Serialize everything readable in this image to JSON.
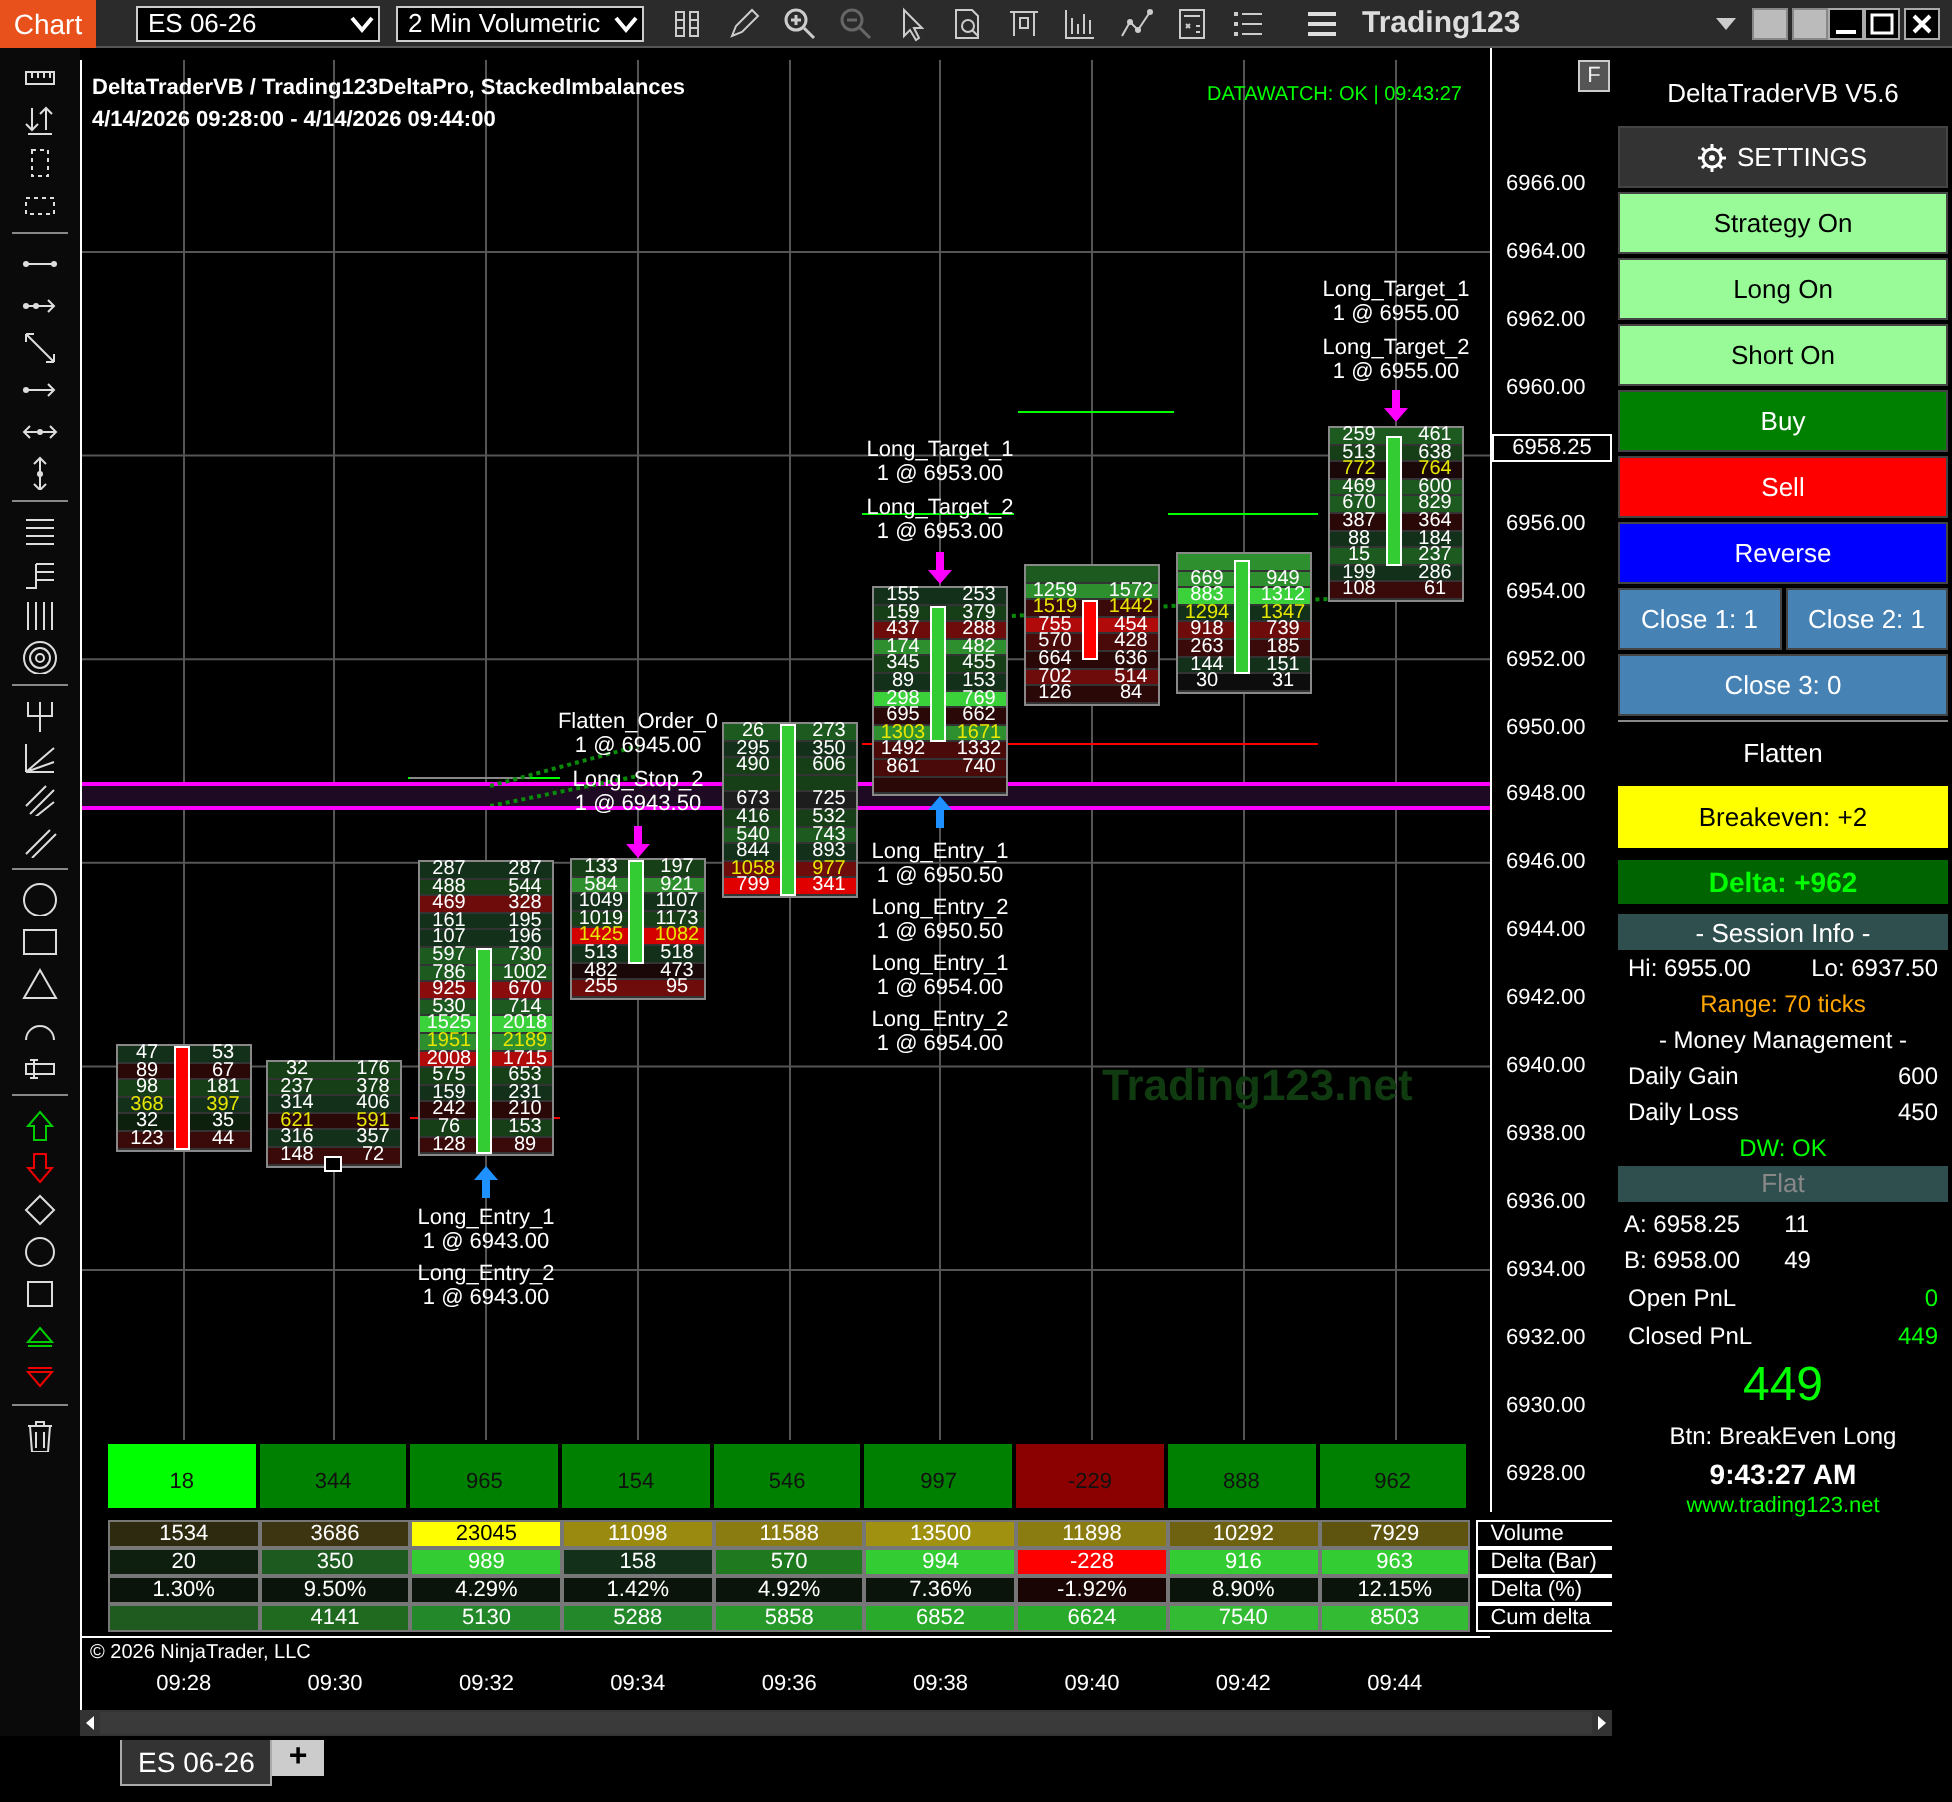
{
  "topbar": {
    "tab": "Chart",
    "instrument": "ES 06-26",
    "interval": "2 Min Volumetric",
    "workspace": "Trading123"
  },
  "chart": {
    "title": "DeltaTraderVB / Trading123DeltaPro, StackedImbalances",
    "range": "4/14/2026 09:28:00 - 4/14/2026 09:44:00",
    "datawatch": "DATAWATCH: OK | 09:43:27",
    "f_button": "F",
    "watermark": "Trading123.net",
    "copyright": "© 2026 NinjaTrader, LLC",
    "price_labels": [
      "6966.00",
      "6964.00",
      "6962.00",
      "6960.00",
      "6956.00",
      "6954.00",
      "6952.00",
      "6950.00",
      "6948.00",
      "6946.00",
      "6944.00",
      "6942.00",
      "6940.00",
      "6938.00",
      "6936.00",
      "6934.00",
      "6932.00",
      "6930.00",
      "6928.00"
    ],
    "last_price": "6958.25",
    "bars": [
      {
        "kind": "down",
        "rows": [
          {
            "bid": "47",
            "ask": "53",
            "color": "#12301a",
            "kind": "plain"
          },
          {
            "bid": "89",
            "ask": "67",
            "color": "#2a0808",
            "kind": "plain"
          },
          {
            "bid": "98",
            "ask": "181",
            "color": "#163f18",
            "kind": "plain"
          },
          {
            "bid": "368",
            "ask": "397",
            "color": "#12301a",
            "kind": "poc"
          },
          {
            "bid": "32",
            "ask": "35",
            "color": "#0d200d",
            "kind": "plain"
          },
          {
            "bid": "123",
            "ask": "44",
            "color": "#3a0a0a",
            "kind": "plain"
          }
        ]
      },
      {
        "kind": "doji",
        "rows": [
          {
            "bid": "32",
            "ask": "176",
            "color": "#163f18",
            "kind": "plain"
          },
          {
            "bid": "237",
            "ask": "378",
            "color": "#163f18",
            "kind": "plain"
          },
          {
            "bid": "314",
            "ask": "406",
            "color": "#12301a",
            "kind": "plain"
          },
          {
            "bid": "621",
            "ask": "591",
            "color": "#2a0808",
            "kind": "poc"
          },
          {
            "bid": "316",
            "ask": "357",
            "color": "#12301a",
            "kind": "plain"
          },
          {
            "bid": "148",
            "ask": "72",
            "color": "#3a0a0a",
            "kind": "plain"
          }
        ]
      },
      {
        "kind": "up",
        "rows": [
          {
            "bid": "287",
            "ask": "287",
            "color": "#12301a",
            "kind": "plain"
          },
          {
            "bid": "488",
            "ask": "544",
            "color": "#163f18",
            "kind": "plain"
          },
          {
            "bid": "469",
            "ask": "328",
            "color": "#6e0b0b",
            "kind": "plain"
          },
          {
            "bid": "161",
            "ask": "195",
            "color": "#12301a",
            "kind": "plain"
          },
          {
            "bid": "107",
            "ask": "196",
            "color": "#12301a",
            "kind": "plain"
          },
          {
            "bid": "597",
            "ask": "730",
            "color": "#1d5a1f",
            "kind": "plain"
          },
          {
            "bid": "786",
            "ask": "1002",
            "color": "#1d5a1f",
            "kind": "plain"
          },
          {
            "bid": "925",
            "ask": "670",
            "color": "#8a0c0c",
            "kind": "plain"
          },
          {
            "bid": "530",
            "ask": "714",
            "color": "#1d5a1f",
            "kind": "plain"
          },
          {
            "bid": "1525",
            "ask": "2018",
            "color": "#3ad13a",
            "kind": "plain"
          },
          {
            "bid": "1951",
            "ask": "2189",
            "color": "#2e8f2e",
            "kind": "poc"
          },
          {
            "bid": "2008",
            "ask": "1715",
            "color": "#b00a0a",
            "kind": "plain"
          },
          {
            "bid": "575",
            "ask": "653",
            "color": "#163f18",
            "kind": "plain"
          },
          {
            "bid": "159",
            "ask": "231",
            "color": "#12301a",
            "kind": "plain"
          },
          {
            "bid": "242",
            "ask": "210",
            "color": "#2a0808",
            "kind": "plain"
          },
          {
            "bid": "76",
            "ask": "153",
            "color": "#163f18",
            "kind": "plain"
          },
          {
            "bid": "128",
            "ask": "89",
            "color": "#3a0a0a",
            "kind": "plain"
          }
        ]
      },
      {
        "kind": "up",
        "rows": [
          {
            "bid": "133",
            "ask": "197",
            "color": "#163f18",
            "kind": "plain"
          },
          {
            "bid": "584",
            "ask": "921",
            "color": "#2e8f2e",
            "kind": "plain"
          },
          {
            "bid": "1049",
            "ask": "1107",
            "color": "#12301a",
            "kind": "plain"
          },
          {
            "bid": "1019",
            "ask": "1173",
            "color": "#163f18",
            "kind": "plain"
          },
          {
            "bid": "1425",
            "ask": "1082",
            "color": "#d40000",
            "kind": "poc"
          },
          {
            "bid": "513",
            "ask": "518",
            "color": "#12301a",
            "kind": "plain"
          },
          {
            "bid": "482",
            "ask": "473",
            "color": "#1a0808",
            "kind": "plain"
          },
          {
            "bid": "255",
            "ask": "95",
            "color": "#6e0b0b",
            "kind": "plain"
          }
        ]
      },
      {
        "kind": "up",
        "rows": [
          {
            "bid": "26",
            "ask": "273",
            "color": "#1d5a1f",
            "kind": "plain"
          },
          {
            "bid": "295",
            "ask": "350",
            "color": "#12301a",
            "kind": "plain"
          },
          {
            "bid": "490",
            "ask": "606",
            "color": "#163f18",
            "kind": "plain"
          },
          {
            "color": "#163f18",
            "kind": "hidden"
          },
          {
            "bid": "673",
            "ask": "725",
            "color": "#1d1d1d",
            "kind": "plain"
          },
          {
            "bid": "416",
            "ask": "532",
            "color": "#163f18",
            "kind": "plain"
          },
          {
            "bid": "540",
            "ask": "743",
            "color": "#1d5a1f",
            "kind": "plain"
          },
          {
            "bid": "844",
            "ask": "893",
            "color": "#12301a",
            "kind": "plain"
          },
          {
            "bid": "1058",
            "ask": "977",
            "color": "#6e0b0b",
            "kind": "poc"
          },
          {
            "bid": "799",
            "ask": "341",
            "color": "#e00000",
            "kind": "plain"
          }
        ]
      },
      {
        "kind": "up",
        "rows": [
          {
            "bid": "155",
            "ask": "253",
            "color": "#12301a",
            "kind": "plain"
          },
          {
            "bid": "159",
            "ask": "379",
            "color": "#163f18",
            "kind": "plain"
          },
          {
            "bid": "437",
            "ask": "288",
            "color": "#6e0b0b",
            "kind": "plain"
          },
          {
            "bid": "174",
            "ask": "482",
            "color": "#2e8f2e",
            "kind": "plain"
          },
          {
            "bid": "345",
            "ask": "455",
            "color": "#163f18",
            "kind": "plain"
          },
          {
            "bid": "89",
            "ask": "153",
            "color": "#12301a",
            "kind": "plain"
          },
          {
            "bid": "298",
            "ask": "769",
            "color": "#3ad13a",
            "kind": "plain"
          },
          {
            "bid": "695",
            "ask": "662",
            "color": "#2a0808",
            "kind": "plain"
          },
          {
            "bid": "1303",
            "ask": "1671",
            "color": "#2e8f2e",
            "kind": "poc"
          },
          {
            "bid": "1492",
            "ask": "1332",
            "color": "#4a0a0a",
            "kind": "plain"
          },
          {
            "bid": "861",
            "ask": "740",
            "color": "#4a0a0a",
            "kind": "plain"
          },
          {
            "color": "#2a0808",
            "kind": "hidden"
          }
        ]
      },
      {
        "kind": "down",
        "rows": [
          {
            "color": "#1d5a1f",
            "kind": "hidden"
          },
          {
            "bid": "1259",
            "ask": "1572",
            "color": "#2e8f2e",
            "kind": "plain"
          },
          {
            "bid": "1519",
            "ask": "1442",
            "color": "#3a0a0a",
            "kind": "poc"
          },
          {
            "bid": "755",
            "ask": "454",
            "color": "#b00a0a",
            "kind": "plain"
          },
          {
            "bid": "570",
            "ask": "428",
            "color": "#4a0a0a",
            "kind": "plain"
          },
          {
            "bid": "664",
            "ask": "636",
            "color": "#2a0808",
            "kind": "plain"
          },
          {
            "bid": "702",
            "ask": "514",
            "color": "#6e0b0b",
            "kind": "plain"
          },
          {
            "bid": "126",
            "ask": "84",
            "color": "#2a0808",
            "kind": "plain"
          }
        ]
      },
      {
        "kind": "up",
        "rows": [
          {
            "color": "#2e8f2e",
            "kind": "hidden"
          },
          {
            "bid": "669",
            "ask": "949",
            "color": "#2e8f2e",
            "kind": "plain"
          },
          {
            "bid": "883",
            "ask": "1312",
            "color": "#3ad13a",
            "kind": "plain"
          },
          {
            "bid": "1294",
            "ask": "1347",
            "color": "#12301a",
            "kind": "poc"
          },
          {
            "bid": "918",
            "ask": "739",
            "color": "#6e0b0b",
            "kind": "plain"
          },
          {
            "bid": "263",
            "ask": "185",
            "color": "#3a0a0a",
            "kind": "plain"
          },
          {
            "bid": "144",
            "ask": "151",
            "color": "#12301a",
            "kind": "plain"
          },
          {
            "bid": "30",
            "ask": "31",
            "color": "#0d0d0d",
            "kind": "plain"
          }
        ]
      },
      {
        "kind": "up",
        "rows": [
          {
            "bid": "259",
            "ask": "461",
            "color": "#1d5a1f",
            "kind": "plain"
          },
          {
            "bid": "513",
            "ask": "638",
            "color": "#163f18",
            "kind": "plain"
          },
          {
            "bid": "772",
            "ask": "764",
            "color": "#1a0808",
            "kind": "poc"
          },
          {
            "bid": "469",
            "ask": "600",
            "color": "#1d5a1f",
            "kind": "plain"
          },
          {
            "bid": "670",
            "ask": "829",
            "color": "#1d5a1f",
            "kind": "plain"
          },
          {
            "bid": "387",
            "ask": "364",
            "color": "#2a0808",
            "kind": "plain"
          },
          {
            "bid": "88",
            "ask": "184",
            "color": "#12301a",
            "kind": "plain"
          },
          {
            "bid": "15",
            "ask": "237",
            "color": "#1d5a1f",
            "kind": "plain"
          },
          {
            "bid": "199",
            "ask": "286",
            "color": "#12301a",
            "kind": "plain"
          },
          {
            "bid": "108",
            "ask": "61",
            "color": "#3a0a0a",
            "kind": "plain"
          }
        ]
      }
    ],
    "orders": [
      {
        "name": "Flatten_Order_0",
        "detail": "1 @ 6945.00"
      },
      {
        "name": "Long_Stop_2",
        "detail": "1 @ 6943.50"
      },
      {
        "name": "Long_Entry_1",
        "detail": "1 @ 6943.00"
      },
      {
        "name": "Long_Entry_2",
        "detail": "1 @ 6943.00"
      },
      {
        "name": "Long_Target_1",
        "detail": "1 @ 6953.00"
      },
      {
        "name": "Long_Target_2",
        "detail": "1 @ 6953.00"
      },
      {
        "name": "Long_Entry_1",
        "detail": "1 @ 6950.50"
      },
      {
        "name": "Long_Entry_2",
        "detail": "1 @ 6950.50"
      },
      {
        "name": "Long_Entry_1",
        "detail": "1 @ 6954.00"
      },
      {
        "name": "Long_Entry_2",
        "detail": "1 @ 6954.00"
      },
      {
        "name": "Long_Target_1",
        "detail": "1 @ 6955.00"
      },
      {
        "name": "Long_Target_2",
        "detail": "1 @ 6955.00"
      }
    ],
    "delta_boxes": [
      {
        "text": "18",
        "color": "#00ff00"
      },
      {
        "text": "344",
        "color": "#008000"
      },
      {
        "text": "965",
        "color": "#008000"
      },
      {
        "text": "154",
        "color": "#008000"
      },
      {
        "text": "546",
        "color": "#008000"
      },
      {
        "text": "997",
        "color": "#008000"
      },
      {
        "text": "-229",
        "color": "#8b0000"
      },
      {
        "text": "888",
        "color": "#008000"
      },
      {
        "text": "962",
        "color": "#008000"
      }
    ],
    "stats": [
      {
        "label": "Volume",
        "cells": [
          {
            "text": "1534",
            "color": "#2e2a10"
          },
          {
            "text": "3686",
            "color": "#3d3512"
          },
          {
            "text": "23045",
            "color": "#ffff00"
          },
          {
            "text": "11098",
            "color": "#9a8a10"
          },
          {
            "text": "11588",
            "color": "#8a7c10"
          },
          {
            "text": "13500",
            "color": "#a09210"
          },
          {
            "text": "11898",
            "color": "#8a7c10"
          },
          {
            "text": "10292",
            "color": "#6e6210"
          },
          {
            "text": "7929",
            "color": "#5e5410"
          }
        ]
      },
      {
        "label": "Delta (Bar)",
        "cells": [
          {
            "text": "20",
            "color": "#0f1f0f"
          },
          {
            "text": "350",
            "color": "#1d5a1f"
          },
          {
            "text": "989",
            "color": "#33cc33"
          },
          {
            "text": "158",
            "color": "#12301a"
          },
          {
            "text": "570",
            "color": "#1f7a1f"
          },
          {
            "text": "994",
            "color": "#33cc33"
          },
          {
            "text": "-228",
            "color": "#ff0000"
          },
          {
            "text": "916",
            "color": "#33cc33"
          },
          {
            "text": "963",
            "color": "#33cc33"
          }
        ]
      },
      {
        "label": "Delta (%)",
        "cells": [
          {
            "text": "1.30%",
            "color": "#0a140a"
          },
          {
            "text": "9.50%",
            "color": "#0a140a"
          },
          {
            "text": "4.29%",
            "color": "#0a140a"
          },
          {
            "text": "1.42%",
            "color": "#0a140a"
          },
          {
            "text": "4.92%",
            "color": "#0a140a"
          },
          {
            "text": "7.36%",
            "color": "#0a140a"
          },
          {
            "text": "-1.92%",
            "color": "#1a0505"
          },
          {
            "text": "8.90%",
            "color": "#0a140a"
          },
          {
            "text": "12.15%",
            "color": "#0a140a"
          }
        ]
      },
      {
        "label": "Cum delta",
        "cells": [
          {
            "color": "#1f5a1f"
          },
          {
            "text": "4141",
            "color": "#1f6a1f"
          },
          {
            "text": "5130",
            "color": "#22882a"
          },
          {
            "text": "5288",
            "color": "#22882a"
          },
          {
            "text": "5858",
            "color": "#26992a"
          },
          {
            "text": "6852",
            "color": "#2aaa2a"
          },
          {
            "text": "6624",
            "color": "#2aaa2a"
          },
          {
            "text": "7540",
            "color": "#33bb33"
          },
          {
            "text": "8503",
            "color": "#33bb33"
          }
        ]
      }
    ],
    "times": [
      "09:28",
      "09:30",
      "09:32",
      "09:34",
      "09:36",
      "09:38",
      "09:40",
      "09:42",
      "09:44"
    ]
  },
  "panel": {
    "title": "DeltaTraderVB V5.6",
    "settings": "SETTINGS",
    "toggles": [
      {
        "label": "Strategy On",
        "on": true
      },
      {
        "label": "Long On",
        "on": true
      },
      {
        "label": "Short On",
        "on": true
      }
    ],
    "actions": [
      {
        "label": "Buy",
        "color": "#008000"
      },
      {
        "label": "Sell",
        "color": "#ff0000"
      },
      {
        "label": "Reverse",
        "color": "#0000ff"
      }
    ],
    "close_buttons": [
      {
        "label": "Close 1: 1"
      },
      {
        "label": "Close 2: 1"
      },
      {
        "label": "Close 3: 0"
      }
    ],
    "flatten": "Flatten",
    "breakeven": "Breakeven: +2",
    "delta": "Delta: +962",
    "session_header": "-  Session Info  -",
    "hi": "Hi: 6955.00",
    "lo": "Lo: 6937.50",
    "range": "Range: 70 ticks",
    "money_header": "-  Money Management  -",
    "money_rows": [
      {
        "label": "Daily Gain",
        "value": "600"
      },
      {
        "label": "Daily Loss",
        "value": "450"
      }
    ],
    "dw_status": "DW: OK",
    "position": "Flat",
    "quotes": [
      {
        "label": "A: 6958.25",
        "size": "11"
      },
      {
        "label": "B: 6958.00",
        "size": "49"
      }
    ],
    "pnl": [
      {
        "label": "Open PnL",
        "value": "0"
      },
      {
        "label": "Closed PnL",
        "value": "449"
      }
    ],
    "big_pnl": "449",
    "last_button": "Btn: BreakEven Long",
    "clock": "9:43:27 AM",
    "url": "www.trading123.net"
  },
  "tabs": [
    {
      "label": "ES 06-26",
      "selected": true
    },
    {
      "label": "+",
      "selected": false
    }
  ]
}
